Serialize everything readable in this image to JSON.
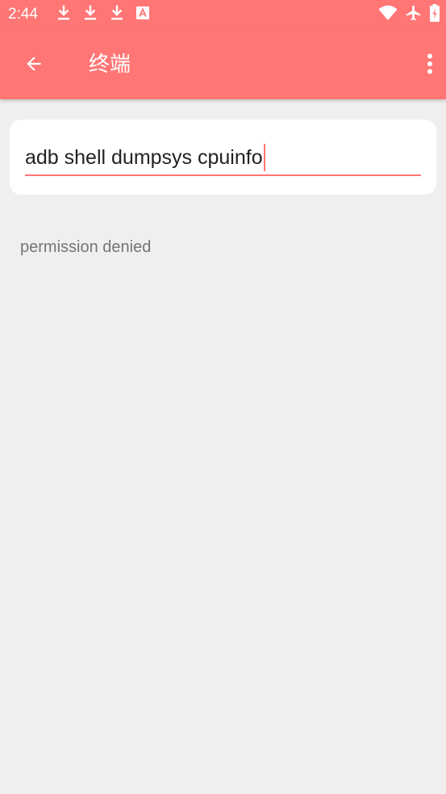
{
  "status_bar": {
    "time": "2:44",
    "left_icons": [
      "download-icon",
      "download-icon",
      "download-icon",
      "a-box-icon"
    ],
    "right_icons": [
      "wifi-icon",
      "airplane-icon",
      "battery-icon"
    ]
  },
  "app_bar": {
    "title": "终端",
    "back_icon": "arrow-back-icon",
    "menu_icon": "more-vert-icon"
  },
  "terminal": {
    "command": "adb shell dumpsys cpuinfo",
    "output": "permission denied"
  },
  "colors": {
    "accent": "#ff7675",
    "background": "#efefef",
    "card": "#ffffff",
    "output_text": "#757575"
  }
}
